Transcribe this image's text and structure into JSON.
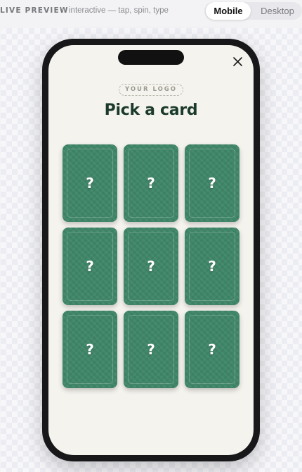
{
  "topbar": {
    "live_label": "LIVE PREVIEW",
    "hint": "interactive — tap, spin, type",
    "mode_mobile": "Mobile",
    "mode_desktop": "Desktop",
    "active_mode": "Mobile"
  },
  "game": {
    "logo_placeholder": "YOUR LOGO",
    "title": "Pick a card",
    "cards": [
      {
        "label": "?"
      },
      {
        "label": "?"
      },
      {
        "label": "?"
      },
      {
        "label": "?"
      },
      {
        "label": "?"
      },
      {
        "label": "?"
      },
      {
        "label": "?"
      },
      {
        "label": "?"
      },
      {
        "label": "?"
      }
    ]
  },
  "colors": {
    "card_back": "#3f8668",
    "title": "#1b3a2c",
    "screen_bg": "#f5f3ee"
  },
  "icons": {
    "close": "close-icon"
  }
}
